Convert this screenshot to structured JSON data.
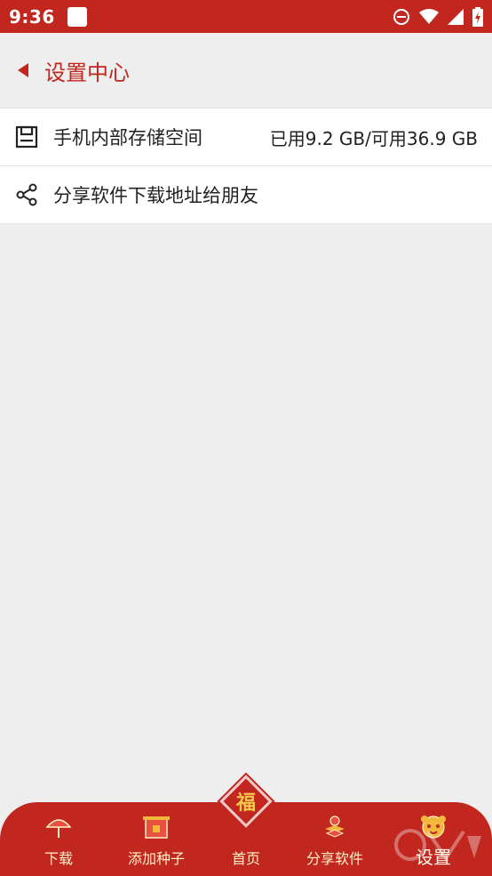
{
  "status_bar": {
    "time": "9:36"
  },
  "header": {
    "title": "设置中心"
  },
  "settings_list": [
    {
      "icon": "save-icon",
      "label": "手机内部存储空间",
      "value": "已用9.2 GB/可用36.9 GB"
    },
    {
      "icon": "share-icon",
      "label": "分享软件下载地址给朋友",
      "value": ""
    }
  ],
  "bottom_nav": {
    "items": [
      {
        "label": "下载",
        "icon": "umbrella-icon"
      },
      {
        "label": "添加种子",
        "icon": "gate-icon"
      },
      {
        "label": "首页",
        "icon": "home-diamond-icon"
      },
      {
        "label": "分享软件",
        "icon": "lantern-icon"
      },
      {
        "label": "设置",
        "icon": "tiger-icon"
      }
    ],
    "home_glyph": "福",
    "active": "设置"
  },
  "colors": {
    "primary": "#c1261f",
    "background": "#eeeeee",
    "nav_text": "#fff1c8"
  }
}
